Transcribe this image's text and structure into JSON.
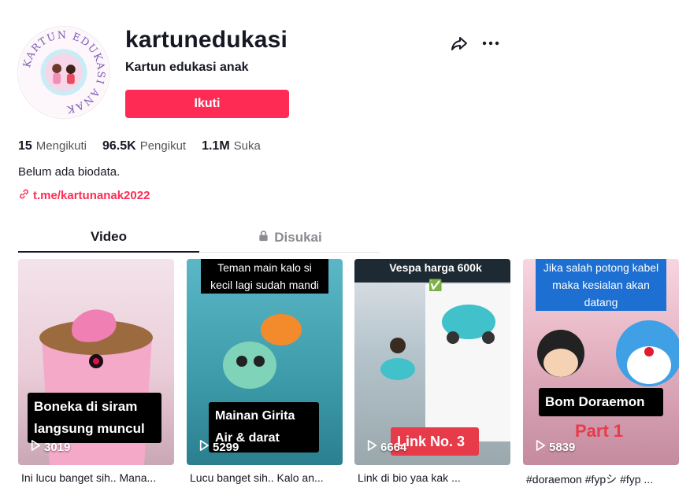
{
  "profile": {
    "username": "kartunedukasi",
    "nickname": "Kartun edukasi anak",
    "follow_label": "Ikuti",
    "avatar_text": "KARTUN EDUKASI ANAK",
    "bio": "Belum ada biodata.",
    "link": "t.me/kartunanak2022"
  },
  "stats": [
    {
      "value": "15",
      "label": "Mengikuti"
    },
    {
      "value": "96.5K",
      "label": "Pengikut"
    },
    {
      "value": "1.1M",
      "label": "Suka"
    }
  ],
  "tabs": [
    {
      "label": "Video"
    },
    {
      "label": "Disukai"
    }
  ],
  "videos": [
    {
      "overlay": "Boneka di siram langsung muncul",
      "top_text": "",
      "views": "3019",
      "caption": "Ini lucu banget sih.. Mana..."
    },
    {
      "overlay": "Mainan Girita Air & darat",
      "top_text": "Teman main kalo si kecil lagi sudah mandi",
      "views": "5299",
      "caption": "Lucu banget sih.. Kalo an..."
    },
    {
      "overlay": "Link No. 3",
      "top_text": "Vespa harga 600k ✅",
      "views": "6664",
      "caption": "Link di bio yaa kak ..."
    },
    {
      "overlay": "Bom Doraemon",
      "sub_overlay": "Part 1",
      "top_text": "Jika salah potong kabel maka kesialan akan datang",
      "views": "5839",
      "caption": "#doraemon #fypシ #fyp ..."
    }
  ],
  "colors": {
    "accent": "#fe2c55",
    "text": "#161823",
    "muted": "#8a8b91"
  },
  "icons": [
    "share-icon",
    "more-icon",
    "link-icon",
    "lock-icon",
    "play-icon"
  ]
}
